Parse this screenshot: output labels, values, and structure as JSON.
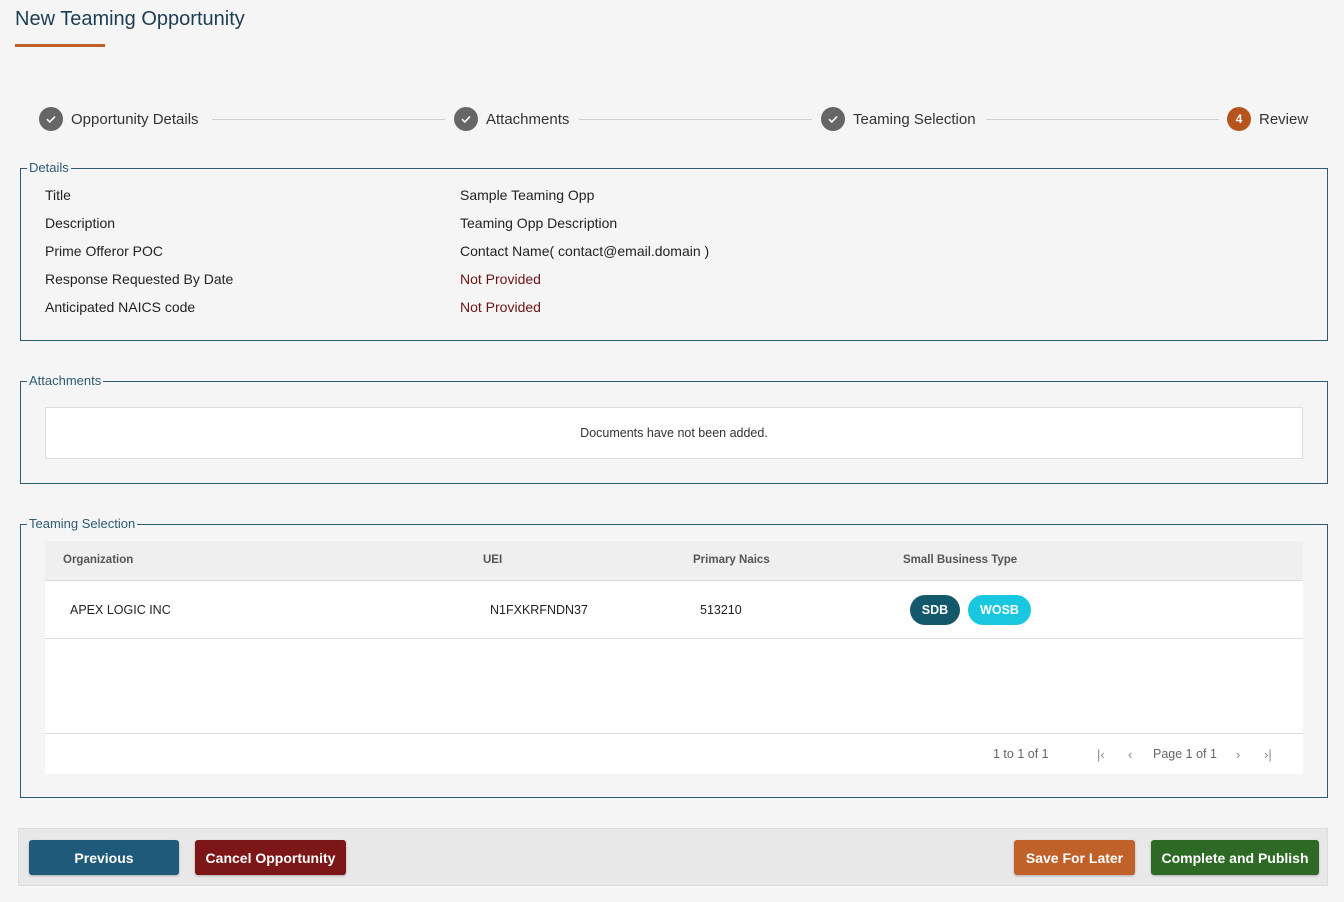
{
  "page": {
    "title": "New Teaming Opportunity"
  },
  "stepper": {
    "steps": [
      {
        "label": "Opportunity Details",
        "status": "complete"
      },
      {
        "label": "Attachments",
        "status": "complete"
      },
      {
        "label": "Teaming Selection",
        "status": "complete"
      },
      {
        "label": "Review",
        "status": "active",
        "number": "4"
      }
    ]
  },
  "details": {
    "legend": "Details",
    "rows": [
      {
        "label": "Title",
        "value": "Sample Teaming Opp"
      },
      {
        "label": "Description",
        "value": "Teaming Opp Description"
      },
      {
        "label": "Prime Offeror POC",
        "value": "Contact Name( contact@email.domain )"
      },
      {
        "label": "Response Requested By Date",
        "value": "Not Provided"
      },
      {
        "label": "Anticipated NAICS code",
        "value": "Not Provided"
      }
    ]
  },
  "attachments": {
    "legend": "Attachments",
    "empty_message": "Documents have not been added."
  },
  "teaming": {
    "legend": "Teaming Selection",
    "columns": [
      "Organization",
      "UEI",
      "Primary Naics",
      "Small Business Type"
    ],
    "rows": [
      {
        "organization": "APEX LOGIC INC",
        "uei": "N1FXKRFNDN37",
        "naics": "513210",
        "types": [
          "SDB",
          "WOSB"
        ]
      }
    ],
    "pagination": {
      "summary": "1 to 1 of 1",
      "page": "Page 1 of 1"
    }
  },
  "actions": {
    "previous": "Previous",
    "cancel": "Cancel Opportunity",
    "save": "Save For Later",
    "publish": "Complete and Publish"
  },
  "colors": {
    "title": "#1b3d52",
    "accent": "#c0612a",
    "border": "#2e5a73",
    "previous": "#1f5a7a",
    "cancel": "#7d1616",
    "save": "#c0612a",
    "publish": "#2e6a26",
    "sdb": "#14596b",
    "wosb": "#19c8e0"
  }
}
